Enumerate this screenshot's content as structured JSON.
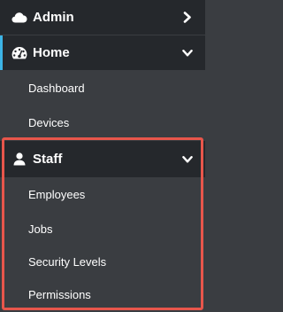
{
  "nav": {
    "admin": {
      "label": "Admin",
      "icon": "cloud-icon",
      "state": "collapsed"
    },
    "home": {
      "label": "Home",
      "icon": "dashboard-gauge-icon",
      "state": "expanded",
      "items": [
        {
          "label": "Dashboard"
        },
        {
          "label": "Devices"
        }
      ]
    },
    "staff": {
      "label": "Staff",
      "icon": "user-icon",
      "state": "expanded",
      "highlight_color": "#e8564b",
      "items": [
        {
          "label": "Employees"
        },
        {
          "label": "Jobs"
        },
        {
          "label": "Security Levels"
        },
        {
          "label": "Permissions"
        }
      ]
    }
  },
  "colors": {
    "header_bg": "#25282c",
    "submenu_bg": "#3a3d41",
    "active_accent": "#3cb4e6",
    "highlight": "#e8564b",
    "text": "#ffffff"
  }
}
